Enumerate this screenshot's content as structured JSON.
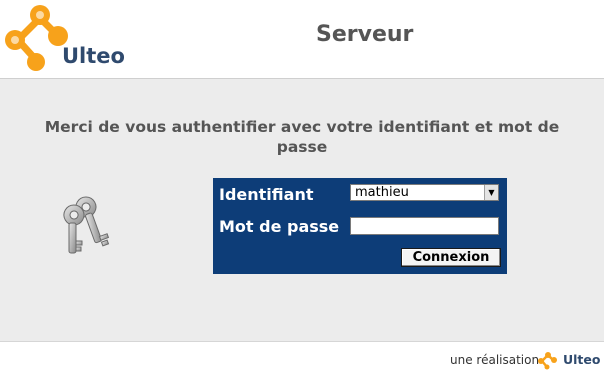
{
  "header": {
    "brand": "Ulteo",
    "title": "Serveur"
  },
  "main": {
    "auth_message": "Merci de vous authentifier avec votre identifiant et mot de passe"
  },
  "login": {
    "user_label": "Identifiant",
    "user_value": "mathieu",
    "password_label": "Mot de passe",
    "password_value": "",
    "submit_label": "Connexion"
  },
  "footer": {
    "credit": "une réalisation",
    "brand": "Ulteo"
  },
  "colors": {
    "brand_orange": "#f7a21b",
    "brand_blue": "#2f4a6e",
    "login_box": "#0d3d78"
  },
  "icons": {
    "logo": "ulteo-logo-icon",
    "keys": "keys-icon"
  }
}
